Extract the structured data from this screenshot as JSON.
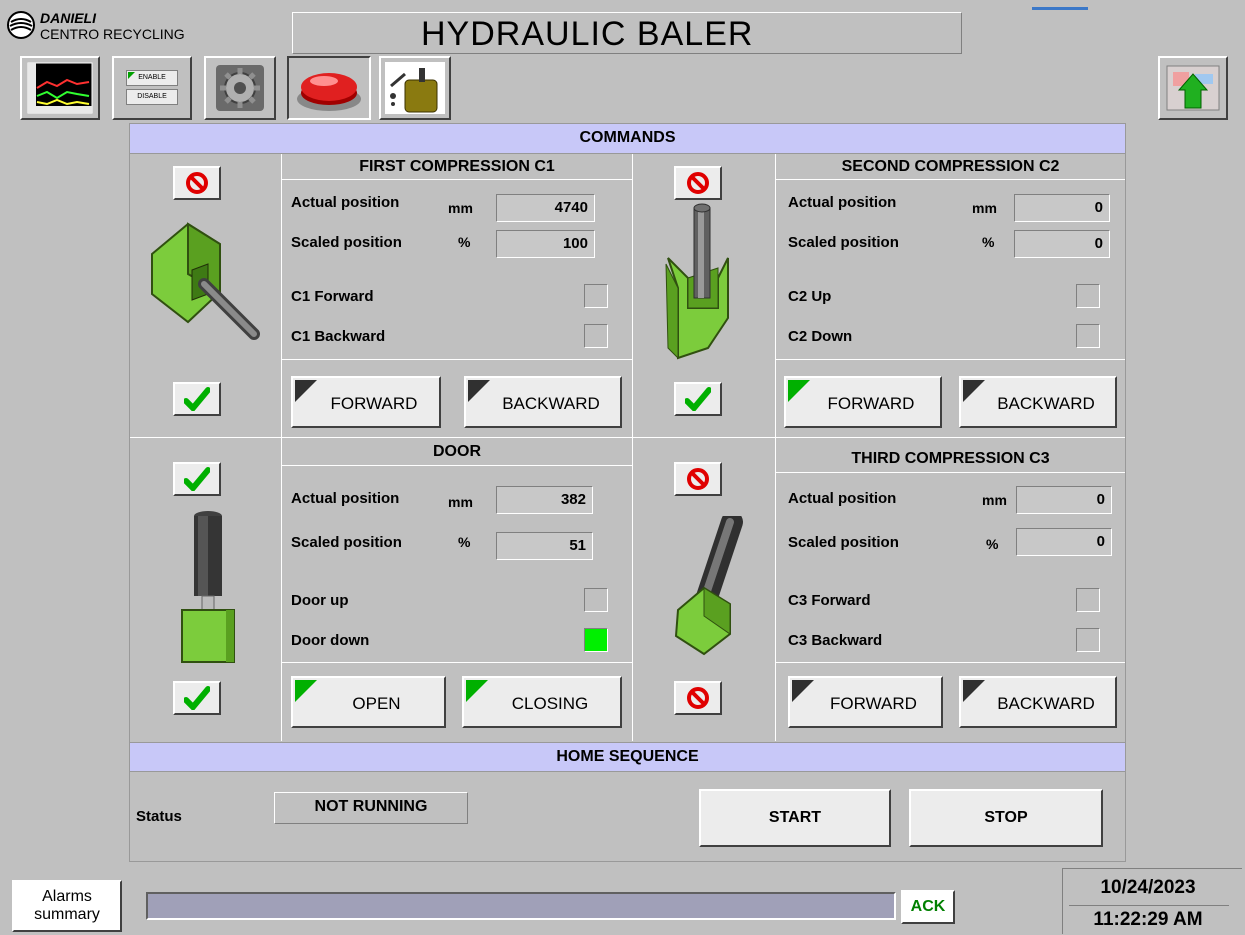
{
  "header": {
    "brand": "DANIELI",
    "subtitle": "CENTRO RECYCLING",
    "title": "HYDRAULIC BALER"
  },
  "toolbar": {
    "trend_icon": "trend-chart-icon",
    "enable_label": "ENABLE",
    "disable_label": "DISABLE",
    "settings_icon": "gear-icon",
    "emergency_icon": "red-button-icon",
    "oil_icon": "oil-can-icon",
    "exit_icon": "exit-arrow-icon"
  },
  "commands": {
    "title": "COMMANDS",
    "c1": {
      "title": "FIRST COMPRESSION C1",
      "actual_label": "Actual position",
      "actual_unit": "mm",
      "actual_value": "4740",
      "scaled_label": "Scaled position",
      "scaled_unit": "%",
      "scaled_value": "100",
      "ind1_label": "C1 Forward",
      "ind1_on": false,
      "ind2_label": "C1 Backward",
      "ind2_on": false,
      "btn1": "FORWARD",
      "btn1_active": false,
      "btn2": "BACKWARD",
      "btn2_active": false,
      "top_icon": "disabled-icon",
      "bottom_icon": "checkmark-icon"
    },
    "c2": {
      "title": "SECOND COMPRESSION C2",
      "actual_label": "Actual position",
      "actual_unit": "mm",
      "actual_value": "0",
      "scaled_label": "Scaled position",
      "scaled_unit": "%",
      "scaled_value": "0",
      "ind1_label": "C2 Up",
      "ind1_on": false,
      "ind2_label": "C2 Down",
      "ind2_on": false,
      "btn1": "FORWARD",
      "btn1_active": true,
      "btn2": "BACKWARD",
      "btn2_active": false,
      "top_icon": "disabled-icon",
      "bottom_icon": "checkmark-icon"
    },
    "door": {
      "title": "DOOR",
      "actual_label": "Actual position",
      "actual_unit": "mm",
      "actual_value": "382",
      "scaled_label": "Scaled position",
      "scaled_unit": "%",
      "scaled_value": "51",
      "ind1_label": "Door up",
      "ind1_on": false,
      "ind2_label": "Door down",
      "ind2_on": true,
      "btn1": "OPEN",
      "btn1_active": true,
      "btn2": "CLOSING",
      "btn2_active": true,
      "top_icon": "checkmark-icon",
      "bottom_icon": "checkmark-icon"
    },
    "c3": {
      "title": "THIRD COMPRESSION C3",
      "actual_label": "Actual position",
      "actual_unit": "mm",
      "actual_value": "0",
      "scaled_label": "Scaled position",
      "scaled_unit": "%",
      "scaled_value": "0",
      "ind1_label": "C3 Forward",
      "ind1_on": false,
      "ind2_label": "C3 Backward",
      "ind2_on": false,
      "btn1": "FORWARD",
      "btn1_active": false,
      "btn2": "BACKWARD",
      "btn2_active": false,
      "top_icon": "disabled-icon",
      "bottom_icon": "disabled-icon"
    }
  },
  "home": {
    "title": "HOME SEQUENCE",
    "status_label": "Status",
    "status_value": "NOT RUNNING",
    "start": "START",
    "stop": "STOP"
  },
  "footer": {
    "alarms_line1": "Alarms",
    "alarms_line2": "summary",
    "ack": "ACK",
    "date": "10/24/2023",
    "time": "11:22:29 AM"
  },
  "colors": {
    "background": "#c0c0c0",
    "band": "#c8c8f8",
    "green_part": "#7ccc3c",
    "led_on": "#00f000"
  }
}
